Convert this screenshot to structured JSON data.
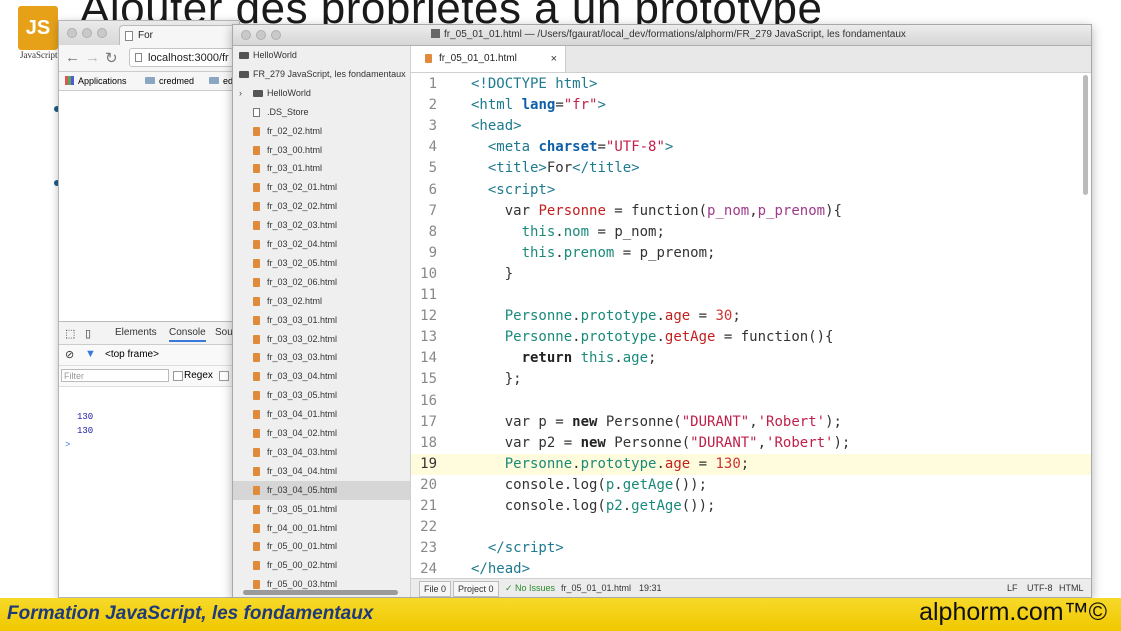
{
  "slide": {
    "title": "Ajouter des propriétés à un prototype",
    "logo_letters": "JS",
    "logo_caption": "JavaScript"
  },
  "browser": {
    "tab_title": "For",
    "url": "localhost:3000/fr",
    "bookmarks": [
      "Applications",
      "credmed",
      "ed"
    ],
    "devtools": {
      "tabs": [
        "Elements",
        "Console",
        "Sou"
      ],
      "active_tab": "Console",
      "frame_selector": "<top frame>",
      "filter_placeholder": "Filter",
      "regex_label": "Regex",
      "console_output": [
        "130",
        "130"
      ],
      "prompt": ">"
    }
  },
  "editor": {
    "window_title": "fr_05_01_01.html — /Users/fgaurat/local_dev/formations/alphorm/FR_279 JavaScript, les fondamentaux",
    "tree": {
      "items": [
        {
          "label": "HelloWorld",
          "kind": "folder",
          "depth": 0
        },
        {
          "label": "FR_279 JavaScript, les fondamentaux",
          "kind": "folder",
          "depth": 0
        },
        {
          "label": "HelloWorld",
          "kind": "folder",
          "depth": 1,
          "collapsed": true
        },
        {
          "label": ".DS_Store",
          "kind": "plain",
          "depth": 1
        },
        {
          "label": "fr_02_02.html",
          "kind": "file",
          "depth": 1
        },
        {
          "label": "fr_03_00.html",
          "kind": "file",
          "depth": 1
        },
        {
          "label": "fr_03_01.html",
          "kind": "file",
          "depth": 1
        },
        {
          "label": "fr_03_02_01.html",
          "kind": "file",
          "depth": 1
        },
        {
          "label": "fr_03_02_02.html",
          "kind": "file",
          "depth": 1
        },
        {
          "label": "fr_03_02_03.html",
          "kind": "file",
          "depth": 1
        },
        {
          "label": "fr_03_02_04.html",
          "kind": "file",
          "depth": 1
        },
        {
          "label": "fr_03_02_05.html",
          "kind": "file",
          "depth": 1
        },
        {
          "label": "fr_03_02_06.html",
          "kind": "file",
          "depth": 1
        },
        {
          "label": "fr_03_02.html",
          "kind": "file",
          "depth": 1
        },
        {
          "label": "fr_03_03_01.html",
          "kind": "file",
          "depth": 1
        },
        {
          "label": "fr_03_03_02.html",
          "kind": "file",
          "depth": 1
        },
        {
          "label": "fr_03_03_03.html",
          "kind": "file",
          "depth": 1
        },
        {
          "label": "fr_03_03_04.html",
          "kind": "file",
          "depth": 1
        },
        {
          "label": "fr_03_03_05.html",
          "kind": "file",
          "depth": 1
        },
        {
          "label": "fr_03_04_01.html",
          "kind": "file",
          "depth": 1
        },
        {
          "label": "fr_03_04_02.html",
          "kind": "file",
          "depth": 1
        },
        {
          "label": "fr_03_04_03.html",
          "kind": "file",
          "depth": 1
        },
        {
          "label": "fr_03_04_04.html",
          "kind": "file",
          "depth": 1
        },
        {
          "label": "fr_03_04_05.html",
          "kind": "file",
          "depth": 1,
          "selected": true
        },
        {
          "label": "fr_03_05_01.html",
          "kind": "file",
          "depth": 1
        },
        {
          "label": "fr_04_00_01.html",
          "kind": "file",
          "depth": 1
        },
        {
          "label": "fr_05_00_01.html",
          "kind": "file",
          "depth": 1
        },
        {
          "label": "fr_05_00_02.html",
          "kind": "file",
          "depth": 1
        },
        {
          "label": "fr_05_00_03.html",
          "kind": "file",
          "depth": 1
        }
      ]
    },
    "open_tab": "fr_05_01_01.html",
    "close_glyph": "×",
    "current_line": 19,
    "code": [
      {
        "n": "1",
        "html": "<span class=\"tag\">&lt;!DOCTYPE html&gt;</span>"
      },
      {
        "n": "2",
        "html": "<span class=\"tag\">&lt;html</span> <span class=\"attr\">lang</span>=<span class=\"str\">\"fr\"</span><span class=\"tag\">&gt;</span>"
      },
      {
        "n": "3",
        "html": "<span class=\"tag\">&lt;head&gt;</span>"
      },
      {
        "n": "4",
        "html": "  <span class=\"tag\">&lt;meta</span> <span class=\"attr\">charset</span>=<span class=\"str\">\"UTF-8\"</span><span class=\"tag\">&gt;</span>"
      },
      {
        "n": "5",
        "html": "  <span class=\"tag\">&lt;title&gt;</span>For<span class=\"tag\">&lt;/title&gt;</span>"
      },
      {
        "n": "6",
        "html": "  <span class=\"tag\">&lt;script&gt;</span>"
      },
      {
        "n": "7",
        "html": "    var <span class=\"ident\">Personne</span> = function(<span class=\"kw\">p_nom</span>,<span class=\"kw\">p_prenom</span>){"
      },
      {
        "n": "8",
        "html": "      <span class=\"prop\">this</span>.<span class=\"prop\">nom</span> = p_nom;"
      },
      {
        "n": "9",
        "html": "      <span class=\"prop\">this</span>.<span class=\"prop\">prenom</span> = p_prenom;"
      },
      {
        "n": "10",
        "html": "    }"
      },
      {
        "n": "11",
        "html": ""
      },
      {
        "n": "12",
        "html": "    <span class=\"prop\">Personne</span>.<span class=\"prop\">prototype</span>.<span class=\"ident\">age</span> = <span class=\"num\">30</span>;"
      },
      {
        "n": "13",
        "html": "    <span class=\"prop\">Personne</span>.<span class=\"prop\">prototype</span>.<span class=\"ident\">getAge</span> = function(){"
      },
      {
        "n": "14",
        "html": "      <span class=\"bold\">return</span> <span class=\"prop\">this</span>.<span class=\"prop\">age</span>;"
      },
      {
        "n": "15",
        "html": "    };"
      },
      {
        "n": "16",
        "html": ""
      },
      {
        "n": "17",
        "html": "    var p = <span class=\"bold\">new</span> Personne(<span class=\"str\">\"DURANT\"</span>,<span class=\"str\">'Robert'</span>);"
      },
      {
        "n": "18",
        "html": "    var p2 = <span class=\"bold\">new</span> Personne(<span class=\"str\">\"DURANT\"</span>,<span class=\"str\">'Robert'</span>);"
      },
      {
        "n": "19",
        "html": "    <span class=\"prop\">Personne</span>.<span class=\"prop\">prototype</span>.<span class=\"ident\">age</span> = <span class=\"num\">130</span>;"
      },
      {
        "n": "20",
        "html": "    console.log(<span class=\"prop\">p</span>.<span class=\"prop\">getAge</span>());"
      },
      {
        "n": "21",
        "html": "    console.log(<span class=\"prop\">p2</span>.<span class=\"prop\">getAge</span>());"
      },
      {
        "n": "22",
        "html": ""
      },
      {
        "n": "23",
        "html": "  <span class=\"tag\">&lt;/script&gt;</span>"
      },
      {
        "n": "24",
        "html": "<span class=\"tag\">&lt;/head&gt;</span>"
      }
    ],
    "status": {
      "file_count": "File 0",
      "project_count": "Project 0",
      "issues": "✓ No Issues",
      "filename": "fr_05_01_01.html",
      "cursor": "19:31",
      "line_ending": "LF",
      "encoding": "UTF-8",
      "grammar": "HTML"
    }
  },
  "footer": {
    "left": "Formation JavaScript, les fondamentaux",
    "right": "alphorm.com™©",
    "color": "#f0c800"
  }
}
